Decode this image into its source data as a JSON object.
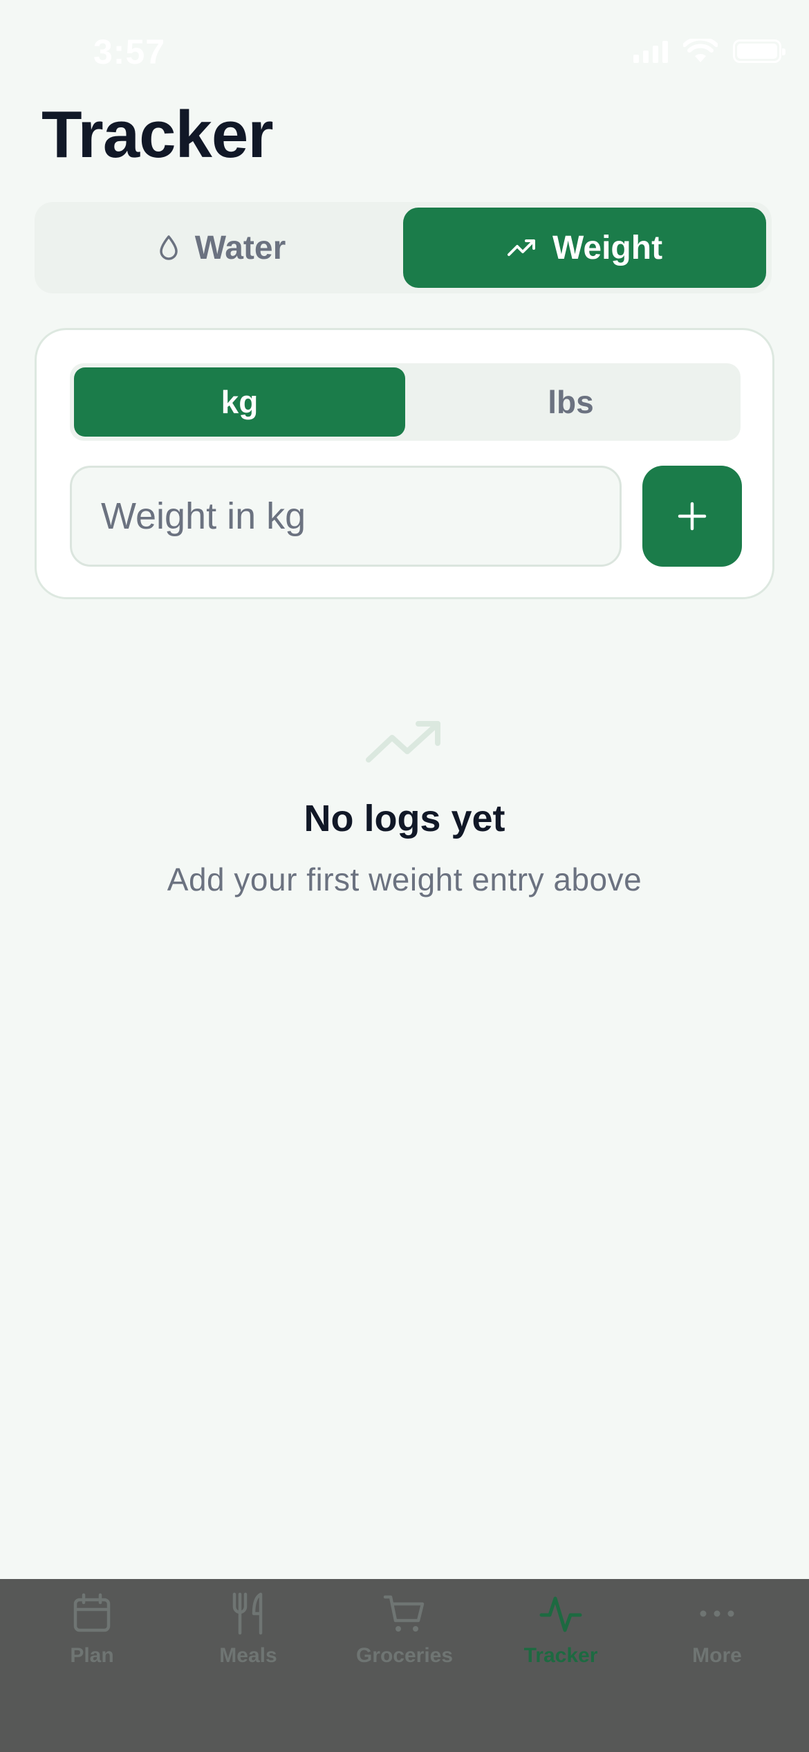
{
  "status_bar": {
    "time": "3:57"
  },
  "page": {
    "title": "Tracker"
  },
  "mode_switch": {
    "tabs": [
      {
        "label": "Water",
        "icon": "droplet-icon",
        "active": false
      },
      {
        "label": "Weight",
        "icon": "trending-up-icon",
        "active": true
      }
    ]
  },
  "weight_card": {
    "units": [
      {
        "label": "kg",
        "active": true
      },
      {
        "label": "lbs",
        "active": false
      }
    ],
    "input": {
      "value": "",
      "placeholder": "Weight in kg"
    },
    "add_icon": "plus-icon"
  },
  "empty_state": {
    "icon": "trending-up-icon",
    "title": "No logs yet",
    "subtitle": "Add your first weight entry above"
  },
  "tab_bar": {
    "items": [
      {
        "label": "Plan",
        "icon": "calendar-icon",
        "active": false
      },
      {
        "label": "Meals",
        "icon": "utensils-icon",
        "active": false
      },
      {
        "label": "Groceries",
        "icon": "cart-icon",
        "active": false
      },
      {
        "label": "Tracker",
        "icon": "activity-icon",
        "active": true
      },
      {
        "label": "More",
        "icon": "more-dots-icon",
        "active": false
      }
    ]
  },
  "colors": {
    "accent": "#1b7c4a",
    "background": "#f4f8f5",
    "tab_bar_overlay": "#575857"
  }
}
